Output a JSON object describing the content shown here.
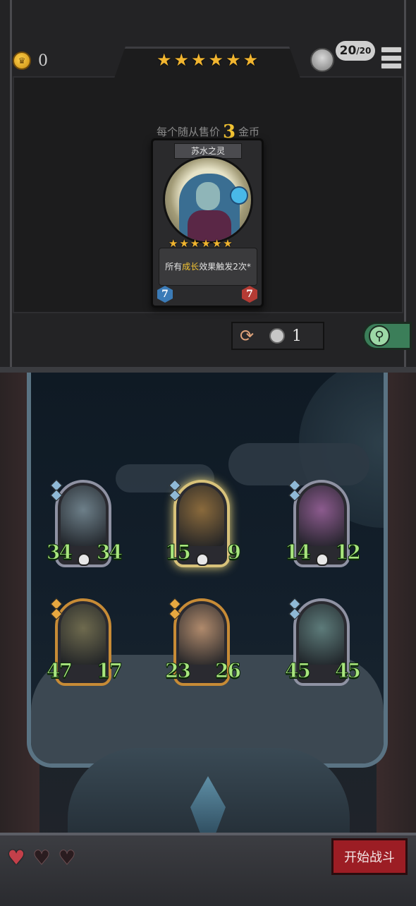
{
  "header": {
    "coins": "0",
    "tier_stars": 6,
    "population": "20",
    "population_max": "/20"
  },
  "shop": {
    "sell_prefix": "每个随从售价",
    "sell_price": "3",
    "sell_suffix": "金币",
    "refresh_cost": "1"
  },
  "featured_card": {
    "name": "苏水之灵",
    "stars": 6,
    "text_pre": "所有",
    "text_highlight": "成长",
    "text_post": "效果触发2次*",
    "attack": "7",
    "health": "7"
  },
  "board": {
    "row1": [
      {
        "attack": "34",
        "health": "34",
        "frame": "silver",
        "art_color": "#6d7f89"
      },
      {
        "attack": "15",
        "health": "9",
        "frame": "glow",
        "art_color": "#8a6a3c"
      },
      {
        "attack": "14",
        "health": "12",
        "frame": "silver",
        "art_color": "#8c5b8e"
      }
    ],
    "row2": [
      {
        "attack": "47",
        "health": "17",
        "frame": "gold",
        "art_color": "#6e6a4e"
      },
      {
        "attack": "23",
        "health": "26",
        "frame": "gold",
        "art_color": "#b08a6c"
      },
      {
        "attack": "45",
        "health": "45",
        "frame": "silver",
        "art_color": "#5d7b7a"
      }
    ]
  },
  "footer": {
    "hearts_total": 3,
    "hearts_remaining": 1,
    "battle_label": "开始战斗"
  },
  "colors": {
    "star": "#f1b530",
    "stat_green": "#a9e67e",
    "battle_red": "#9c1d24",
    "highlight": "#f1c232"
  }
}
